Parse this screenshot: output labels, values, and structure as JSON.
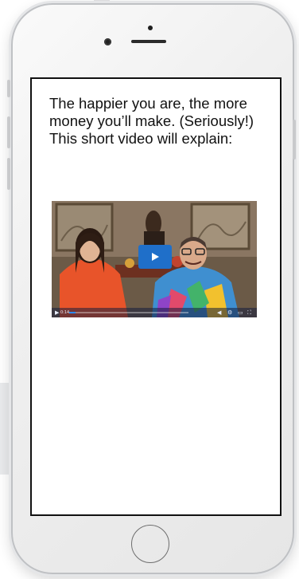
{
  "page": {
    "headline": "The happier you are, the more money you’ll make. (Seriously!) This short video will explain:"
  },
  "video": {
    "play_icon": "play-icon",
    "time_label": "0:14",
    "progress": 0.05,
    "control_icons": [
      "volume-icon",
      "settings-icon",
      "cast-icon",
      "fullscreen-icon"
    ]
  },
  "colors": {
    "play_button": "#1f6fc9",
    "progress_fill": "#2e8bff",
    "screen_border": "#111111"
  }
}
